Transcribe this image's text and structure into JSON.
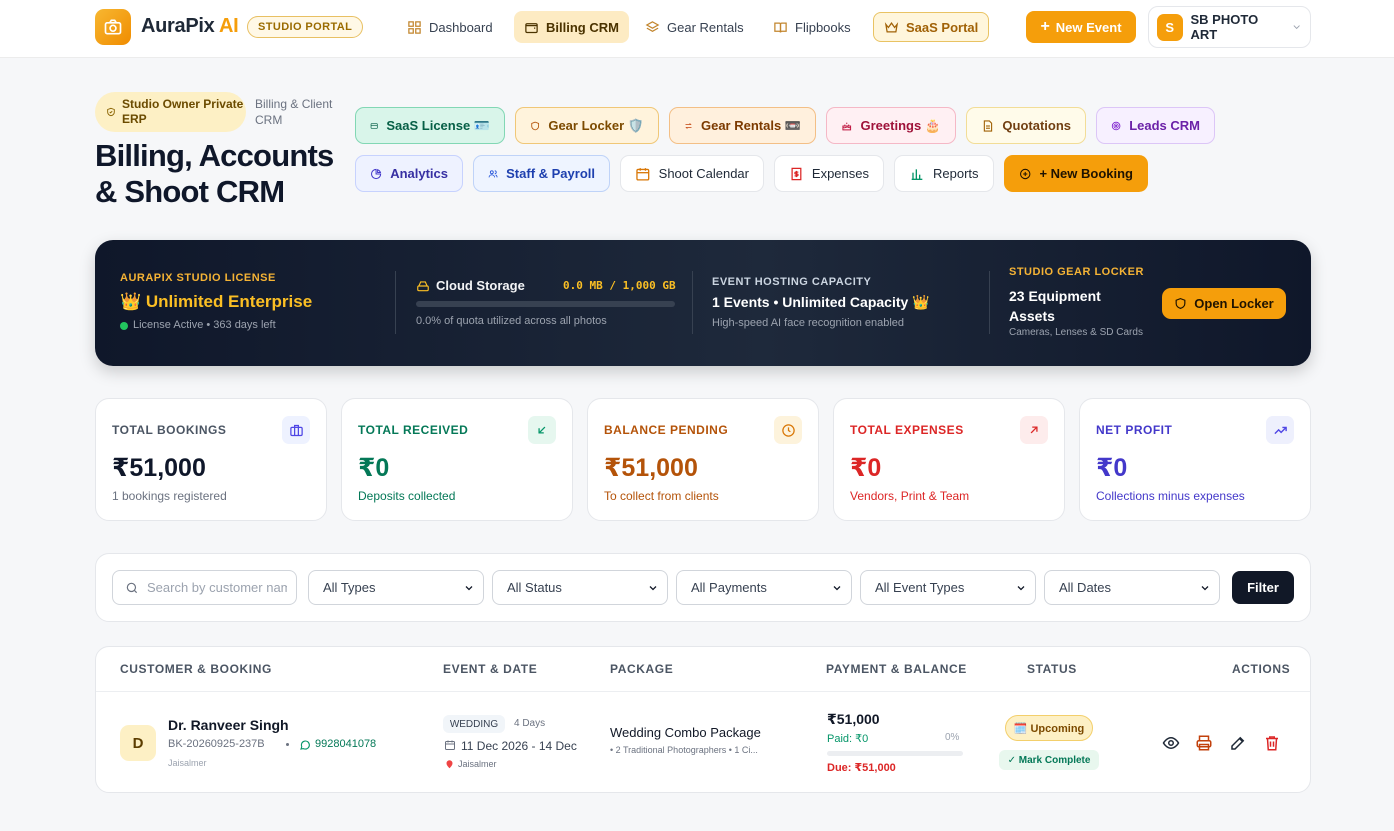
{
  "brand": {
    "name": "AuraPix",
    "ai": "AI",
    "portal_badge": "STUDIO PORTAL"
  },
  "nav": [
    {
      "label": "Dashboard",
      "icon": "grid-icon"
    },
    {
      "label": "Billing CRM",
      "icon": "wallet-icon",
      "active": true
    },
    {
      "label": "Gear Rentals",
      "icon": "layers-icon"
    },
    {
      "label": "Flipbooks",
      "icon": "book-icon"
    },
    {
      "label": "SaaS Portal",
      "icon": "crown-icon"
    }
  ],
  "topbar": {
    "new_event": "New Event",
    "account_initial": "S",
    "account_name": "SB PHOTO ART"
  },
  "header": {
    "owner_badge": "Studio Owner Private ERP",
    "subtitle": "Billing & Client CRM",
    "title": "Billing, Accounts & Shoot CRM"
  },
  "modules": {
    "saas": "SaaS License 🪪",
    "gear_locker": "Gear Locker 🛡️",
    "gear_rentals": "Gear Rentals 📼",
    "greetings": "Greetings 🎂",
    "quotations": "Quotations",
    "leads": "Leads CRM",
    "analytics": "Analytics",
    "staff": "Staff & Payroll",
    "calendar": "Shoot Calendar",
    "expenses": "Expenses",
    "reports": "Reports",
    "new_booking": "+ New Booking"
  },
  "license": {
    "label": "AURAPIX STUDIO LICENSE",
    "plan": "👑 Unlimited Enterprise",
    "status": "License Active • 363 days left",
    "storage_label": "Cloud Storage",
    "storage_value": "0.0 MB / 1,000 GB",
    "storage_percent": 0,
    "storage_note": "0.0% of quota utilized across all photos",
    "hosting_label": "EVENT HOSTING CAPACITY",
    "hosting_value": "1 Events • Unlimited Capacity 👑",
    "hosting_note": "High-speed AI face recognition enabled",
    "gear_label": "STUDIO GEAR LOCKER",
    "gear_value": "23 Equipment Assets",
    "gear_note": "Cameras, Lenses & SD Cards",
    "open_locker": "Open Locker"
  },
  "stats": {
    "bookings": {
      "label": "TOTAL BOOKINGS",
      "value": "₹51,000",
      "sub": "1 bookings registered"
    },
    "received": {
      "label": "TOTAL RECEIVED",
      "value": "₹0",
      "sub": "Deposits collected"
    },
    "pending": {
      "label": "BALANCE PENDING",
      "value": "₹51,000",
      "sub": "To collect from clients"
    },
    "expenses": {
      "label": "TOTAL EXPENSES",
      "value": "₹0",
      "sub": "Vendors, Print & Team"
    },
    "profit": {
      "label": "NET PROFIT",
      "value": "₹0",
      "sub": "Collections minus expenses"
    }
  },
  "filters": {
    "search_placeholder": "Search by customer name...",
    "types": "All Types",
    "status": "All Status",
    "payments": "All Payments",
    "event_types": "All Event Types",
    "dates": "All Dates",
    "filter_button": "Filter"
  },
  "table": {
    "headers": [
      "CUSTOMER & BOOKING",
      "EVENT & DATE",
      "PACKAGE",
      "PAYMENT & BALANCE",
      "STATUS",
      "ACTIONS"
    ],
    "rows": [
      {
        "initial": "D",
        "name": "Dr. Ranveer Singh",
        "booking_id": "BK-20260925-237B",
        "phone": "9928041078",
        "city": "Jaisalmer",
        "event_type": "WEDDING",
        "duration": "4 Days",
        "dates": "11 Dec 2026 - 14 Dec",
        "venue": "Jaisalmer",
        "package": "Wedding Combo Package",
        "package_detail": "• 2 Traditional Photographers • 1 Ci...",
        "amount": "₹51,000",
        "paid": "Paid: ₹0",
        "paid_percent_label": "0%",
        "paid_percent": 0,
        "due": "Due: ₹51,000",
        "status": "🗓️ Upcoming",
        "mark_complete": "✓ Mark Complete"
      }
    ]
  },
  "colors": {
    "accent": "#f59e0b",
    "dark": "#0f172a",
    "success": "#047857",
    "danger": "#dc2626",
    "indigo": "#4338ca"
  }
}
